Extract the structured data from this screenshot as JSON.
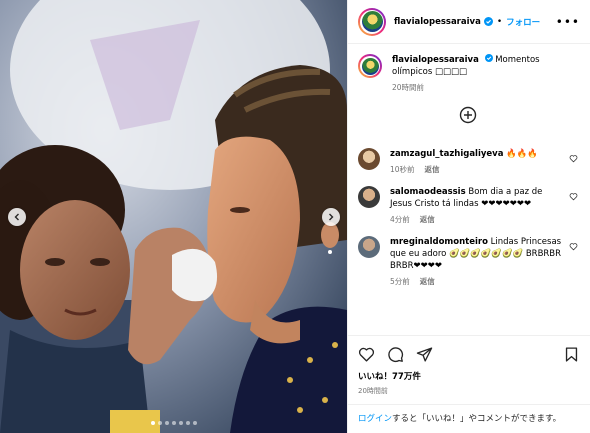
{
  "post": {
    "username": "flavialopessaraiva",
    "follow_label": "フォロー",
    "separator": "•",
    "caption_text": "Momentos olímpicos",
    "caption_emoji": "□□□□",
    "caption_time": "20時間前",
    "likes": "いいね！77万件",
    "posted": "20時間前"
  },
  "comments": [
    {
      "username": "zamzagul_tazhigaliyeva",
      "text": "🔥🔥🔥",
      "time": "10秒前",
      "reply": "返信"
    },
    {
      "username": "salomaodeassis",
      "text": "Bom dia a paz de Jesus Cristo tá lindas ❤❤❤❤❤❤❤",
      "time": "4分前",
      "reply": "返信"
    },
    {
      "username": "mreginaldomonteiro",
      "text": "Lindas Princesas que eu adoro 🥑🥑🥑🥑🥑🥑🥑 BRBRBR BRBR❤❤❤❤",
      "time": "5分前",
      "reply": "返信"
    }
  ],
  "login_prompt": {
    "link": "ログイン",
    "text": "すると「いいね！」やコメントができます。"
  },
  "icons": [
    "more-options-icon",
    "verified-badge-icon",
    "load-more-comments-icon",
    "heart-icon",
    "comment-icon",
    "share-icon",
    "save-icon",
    "chevron-left-icon",
    "chevron-right-icon"
  ],
  "carousel": {
    "slides": 7,
    "active": 0
  }
}
